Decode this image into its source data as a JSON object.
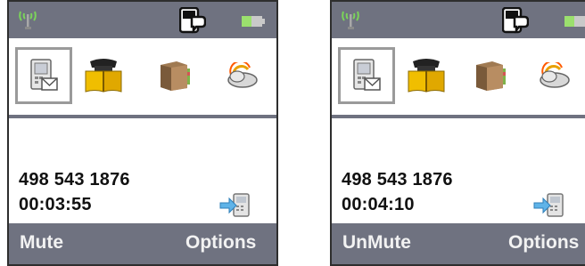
{
  "phones": [
    {
      "call": {
        "number": "498 543 1876",
        "timer": "00:03:55"
      },
      "softkeys": {
        "left": "Mute",
        "right": "Options"
      }
    },
    {
      "call": {
        "number": "498 543 1876",
        "timer": "00:04:10"
      },
      "softkeys": {
        "left": "UnMute",
        "right": "Options"
      }
    }
  ],
  "icons": {
    "status": [
      "signal-antenna-icon",
      "talk-mode-icon",
      "battery-icon"
    ],
    "apps": [
      "messages-icon",
      "phonebook-icon",
      "box-icon",
      "weather-icon"
    ],
    "call": "call-transfer-icon"
  },
  "colors": {
    "bar": "#6f7280",
    "softkey_text": "#f2f2f2",
    "signal": "#7bd35a",
    "battery": "#9be06e",
    "phonebook": "#e8b400",
    "selection": "#9a9a9a"
  }
}
